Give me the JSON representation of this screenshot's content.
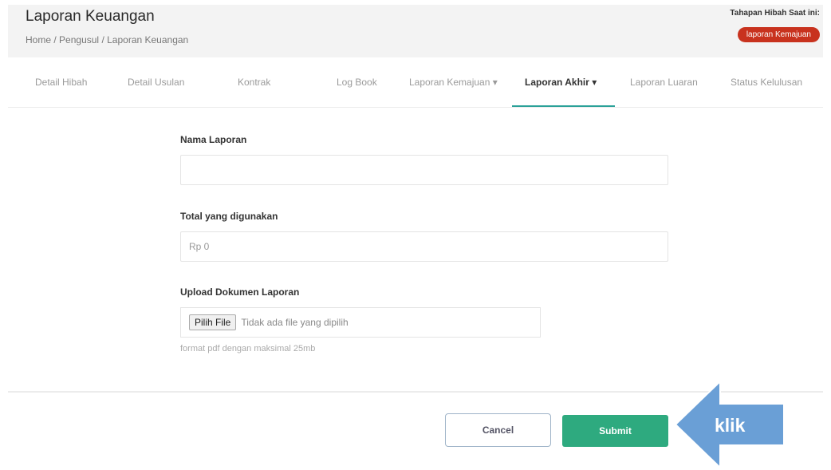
{
  "header": {
    "title": "Laporan Keuangan",
    "breadcrumb": [
      "Home",
      "Pengusul",
      "Laporan Keuangan"
    ],
    "breadcrumb_separator": "/",
    "stage_label": "Tahapan Hibah Saat ini:",
    "stage_badge": "laporan Kemajuan",
    "stage_badge_color": "#c8321e"
  },
  "tabs": [
    {
      "label": "Detail Hibah"
    },
    {
      "label": "Detail Usulan"
    },
    {
      "label": "Kontrak"
    },
    {
      "label": "Log Book"
    },
    {
      "label": "Laporan Kemajuan ▾"
    },
    {
      "label": "Laporan Akhir ▾",
      "active": true
    },
    {
      "label": "Laporan Luaran"
    },
    {
      "label": "Status Kelulusan"
    }
  ],
  "active_tab_color": "#2aa198",
  "form": {
    "nama_label": "Nama Laporan",
    "nama_value": "",
    "total_label": "Total yang digunakan",
    "total_value": "Rp 0",
    "upload_label": "Upload Dokumen Laporan",
    "file_button": "Pilih File",
    "file_status": "Tidak ada file yang dipilih",
    "file_hint": "format pdf dengan maksimal 25mb"
  },
  "actions": {
    "cancel": "Cancel",
    "submit": "Submit",
    "submit_color": "#2eaa7f"
  },
  "annotation": {
    "text": "klik",
    "color": "#6a9fd6",
    "icon": "arrow-left-icon"
  }
}
